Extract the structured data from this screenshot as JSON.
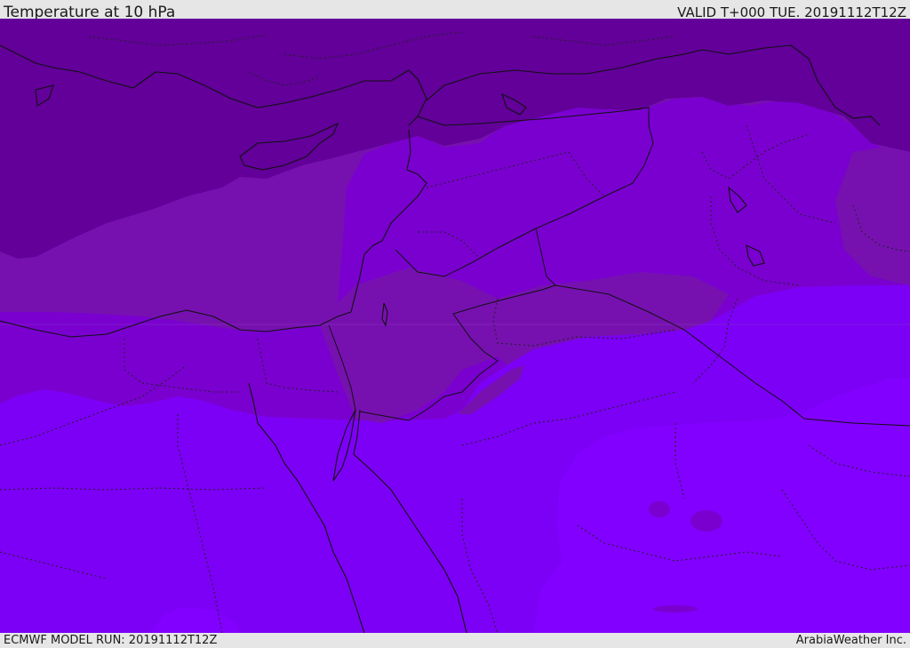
{
  "header": {
    "title": "Temperature at 10 hPa",
    "valid_time": "VALID T+000 TUE. 20191112T12Z"
  },
  "footer": {
    "model_run": "ECMWF MODEL RUN: 20191112T12Z",
    "credit": "ArabiaWeather Inc."
  },
  "colors": {
    "band_coldest": "#620099",
    "band_2": "#7611b0",
    "band_3": "#7a00d0",
    "band_4": "#7c00f5",
    "band_5": "#8200ff",
    "border_line": "#111111",
    "bar_background": "#e6e6e6"
  }
}
